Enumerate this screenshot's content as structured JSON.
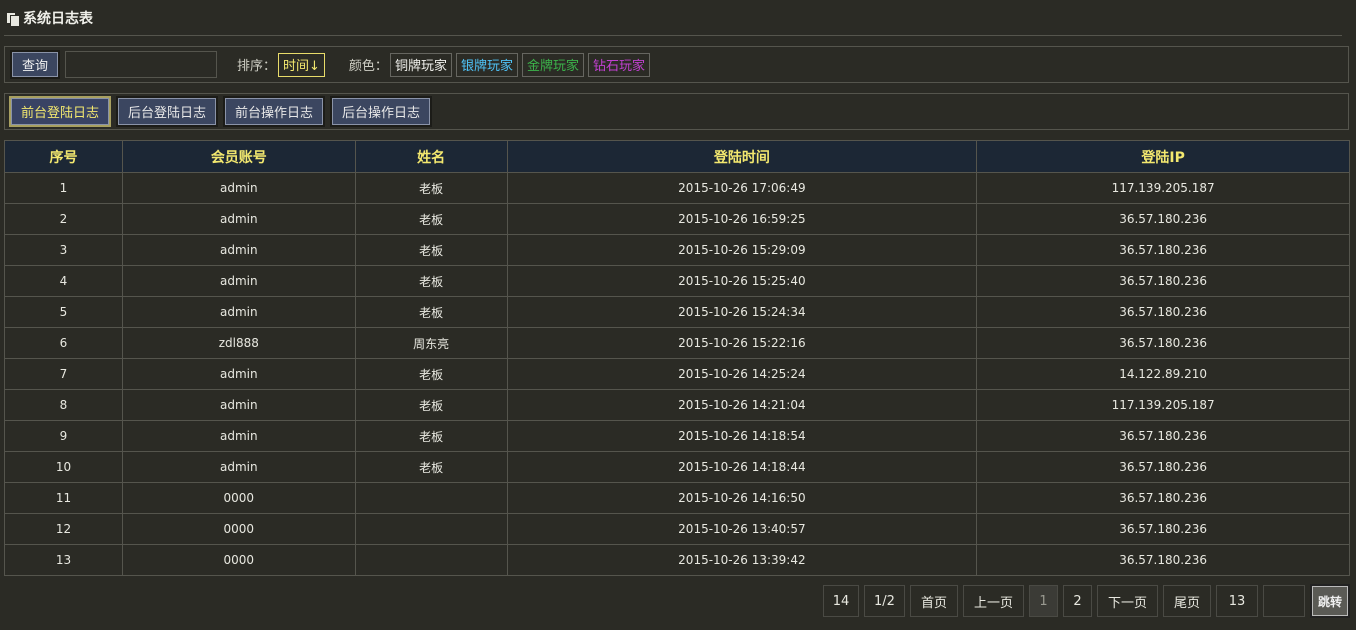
{
  "page": {
    "title": "系统日志表"
  },
  "toolbar": {
    "query_label": "查询",
    "search_value": "",
    "sort_label": "排序：",
    "sort_value": "时间↓",
    "color_label": "颜色：",
    "colors": [
      {
        "label": "铜牌玩家",
        "color": "#f2f2ee"
      },
      {
        "label": "银牌玩家",
        "color": "#4fc3f7"
      },
      {
        "label": "金牌玩家",
        "color": "#3cb44b"
      },
      {
        "label": "钻石玩家",
        "color": "#c040d0"
      }
    ]
  },
  "tabs": [
    {
      "label": "前台登陆日志",
      "active": true
    },
    {
      "label": "后台登陆日志",
      "active": false
    },
    {
      "label": "前台操作日志",
      "active": false
    },
    {
      "label": "后台操作日志",
      "active": false
    }
  ],
  "table": {
    "headers": [
      "序号",
      "会员账号",
      "姓名",
      "登陆时间",
      "登陆IP"
    ],
    "rows": [
      [
        "1",
        "admin",
        "老板",
        "2015-10-26 17:06:49",
        "117.139.205.187"
      ],
      [
        "2",
        "admin",
        "老板",
        "2015-10-26 16:59:25",
        "36.57.180.236"
      ],
      [
        "3",
        "admin",
        "老板",
        "2015-10-26 15:29:09",
        "36.57.180.236"
      ],
      [
        "4",
        "admin",
        "老板",
        "2015-10-26 15:25:40",
        "36.57.180.236"
      ],
      [
        "5",
        "admin",
        "老板",
        "2015-10-26 15:24:34",
        "36.57.180.236"
      ],
      [
        "6",
        "zdl888",
        "周东亮",
        "2015-10-26 15:22:16",
        "36.57.180.236"
      ],
      [
        "7",
        "admin",
        "老板",
        "2015-10-26 14:25:24",
        "14.122.89.210"
      ],
      [
        "8",
        "admin",
        "老板",
        "2015-10-26 14:21:04",
        "117.139.205.187"
      ],
      [
        "9",
        "admin",
        "老板",
        "2015-10-26 14:18:54",
        "36.57.180.236"
      ],
      [
        "10",
        "admin",
        "老板",
        "2015-10-26 14:18:44",
        "36.57.180.236"
      ],
      [
        "11",
        "0000",
        "",
        "2015-10-26 14:16:50",
        "36.57.180.236"
      ],
      [
        "12",
        "0000",
        "",
        "2015-10-26 13:40:57",
        "36.57.180.236"
      ],
      [
        "13",
        "0000",
        "",
        "2015-10-26 13:39:42",
        "36.57.180.236"
      ]
    ]
  },
  "pagination": {
    "total": "14",
    "page_info": "1/2",
    "first": "首页",
    "prev": "上一页",
    "pages": [
      "1",
      "2"
    ],
    "current": "1",
    "next": "下一页",
    "last": "尾页",
    "per_page": "13",
    "jump_value": "",
    "jump_label": "跳转"
  }
}
